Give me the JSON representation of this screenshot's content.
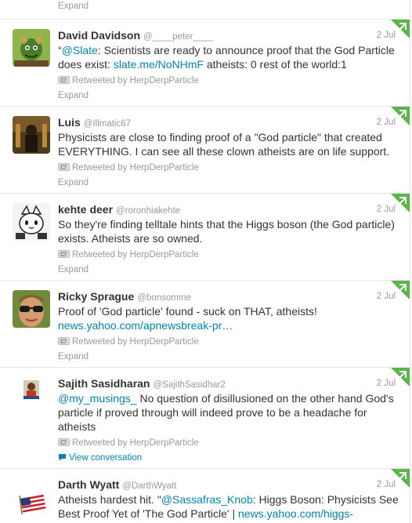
{
  "tweets": [
    {
      "expand_label": "Expand"
    },
    {
      "fullname": "David Davidson",
      "username": "@____peter____",
      "time": "2 Jul",
      "text_link1": "@Slate",
      "text_part1": ": Scientists are ready to announce proof that the God Particle does exist: ",
      "text_link2": "slate.me/NoNHmF",
      "text_part2": " atheists: 0 rest of the world:1",
      "retweet": "Retweeted by HerpDerpParticle",
      "expand_label": "Expand",
      "avatar_icon": "cartoon-avatar-icon"
    },
    {
      "fullname": "Luis",
      "username": "@Illmatic67",
      "time": "2 Jul",
      "text": "Physicists are close to finding proof of a \"God particle\" that created EVERYTHING. I can see all these clown atheists are on life support.",
      "retweet": "Retweeted by HerpDerpParticle",
      "expand_label": "Expand",
      "avatar_icon": "photo-avatar-icon"
    },
    {
      "fullname": "kehte deer",
      "username": "@roronhiakehte",
      "time": "2 Jul",
      "text": "So they're finding telltale hints that the Higgs boson (the God particle) exists. Atheists are so owned.",
      "retweet": "Retweeted by HerpDerpParticle",
      "expand_label": "Expand",
      "avatar_icon": "cartoon-cat-avatar-icon"
    },
    {
      "fullname": "Ricky Sprague",
      "username": "@bonsomme",
      "time": "2 Jul",
      "text": "Proof of 'God particle' found - suck on THAT, atheists!",
      "text_link": "news.yahoo.com/apnewsbreak-pr…",
      "retweet": "Retweeted by HerpDerpParticle",
      "expand_label": "Expand",
      "avatar_icon": "sunglasses-avatar-icon"
    },
    {
      "fullname": "Sajith Sasidharan",
      "username": "@SajithSasidhar2",
      "time": "2 Jul",
      "text_link1": "@my_musings_",
      "text_part1": " No question of disillusioned on the other hand God's particle if proved through will indeed prove to be a headache for atheists",
      "retweet": "Retweeted by HerpDerpParticle",
      "view_conversation": "View conversation",
      "avatar_icon": "small-photo-avatar-icon"
    },
    {
      "fullname": "Darth Wyatt",
      "username": "@DarthWyatt",
      "time": "2 Jul",
      "text_part1": "Atheists hardest hit. \"",
      "text_link1": "@Sassafras_Knob",
      "text_part2": ": Higgs Boson: Physicists See Best Proof Yet of 'The God Particle' | ",
      "text_link2": "news.yahoo.com/higgs-",
      "avatar_icon": "us-flag-avatar-icon"
    }
  ],
  "colors": {
    "link": "#0084b4",
    "muted": "#999999",
    "text": "#333333",
    "favorite_corner": "#5ab54a"
  }
}
